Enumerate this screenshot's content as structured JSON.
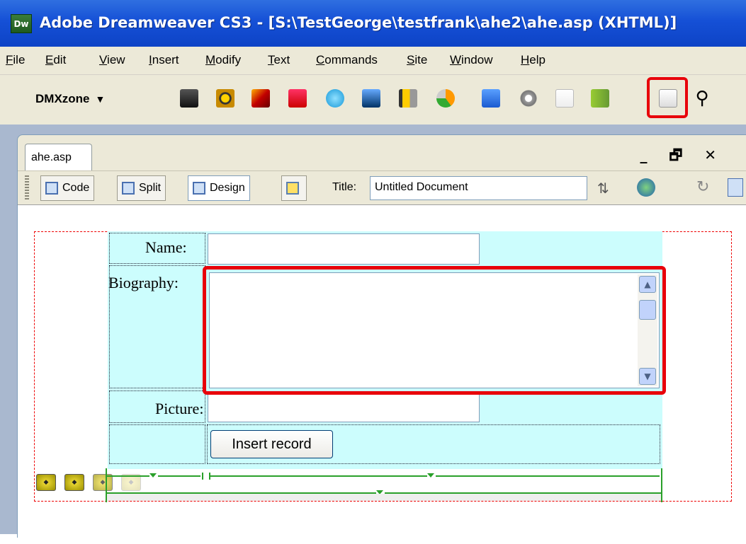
{
  "window": {
    "app_icon": "Dw",
    "title": "Adobe Dreamweaver CS3 - [S:\\TestGeorge\\testfrank\\ahe2\\ahe.asp (XHTML)]"
  },
  "menu": [
    {
      "label": "File",
      "accel": "F",
      "rest": "ile"
    },
    {
      "label": "Edit",
      "accel": "E",
      "rest": "dit"
    },
    {
      "label": "View",
      "accel": "V",
      "rest": "iew"
    },
    {
      "label": "Insert",
      "accel": "I",
      "rest": "nsert"
    },
    {
      "label": "Modify",
      "accel": "M",
      "rest": "odify"
    },
    {
      "label": "Text",
      "accel": "T",
      "rest": "ext"
    },
    {
      "label": "Commands",
      "accel": "C",
      "rest": "ommands"
    },
    {
      "label": "Site",
      "accel": "S",
      "rest": "ite"
    },
    {
      "label": "Window",
      "accel": "W",
      "rest": "indow"
    },
    {
      "label": "Help",
      "accel": "H",
      "rest": "elp"
    }
  ],
  "toolbar": {
    "category": "DMXzone",
    "category_arrow": "▼",
    "icons": [
      "pro-icon",
      "sunflower-icon",
      "flash-icon",
      "media-icon",
      "play-icon",
      "image-icon",
      "filmstrip-icon",
      "chart-icon",
      "rss-icon",
      "gear-icon",
      "upload-icon",
      "book-icon",
      "notepad-icon",
      "search-icon"
    ]
  },
  "document": {
    "tab_label": "ahe.asp",
    "window_controls": "_ 🗗 ✕",
    "view_buttons": {
      "code": "Code",
      "split": "Split",
      "design": "Design"
    },
    "title_label": "Title:",
    "title_value": "Untitled Document"
  },
  "form": {
    "name_label": "Name:",
    "biography_label": "Biography:",
    "picture_label": "Picture:",
    "insert_button": "Insert record"
  },
  "colors": {
    "highlight": "#e8000a",
    "table_bg": "#ccfdfd",
    "titlebar": "#1550d6"
  }
}
